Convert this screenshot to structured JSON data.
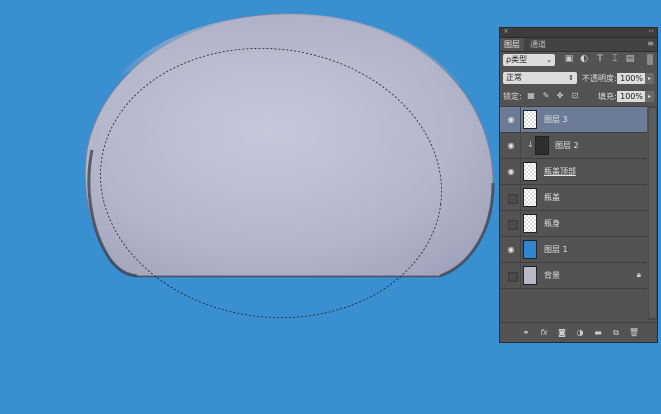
{
  "layers_panel": {
    "close_glyph": "×",
    "collapse_glyph": "‹‹",
    "tabs": [
      {
        "label": "图层",
        "active": true
      },
      {
        "label": "通道",
        "active": false
      }
    ],
    "panel_menu_icon": "panel-menu-icon",
    "filter": {
      "kind_label": "ρ类型",
      "icons": [
        "pixel-filter-icon",
        "adjustment-filter-icon",
        "type-filter-icon",
        "shape-filter-icon",
        "smart-object-filter-icon"
      ]
    },
    "blend_mode": "正常",
    "opacity_label": "不透明度:",
    "opacity_value": "100%",
    "lock_label": "锁定:",
    "lock_icons": [
      "lock-transparent-icon",
      "lock-paint-icon",
      "lock-position-icon",
      "lock-all-icon"
    ],
    "fill_label": "填充:",
    "fill_value": "100%",
    "layers": [
      {
        "name": "图层 3",
        "visible": true,
        "selected": true,
        "thumb": "transparent"
      },
      {
        "name": "图层 2",
        "visible": true,
        "selected": false,
        "thumb": "dark",
        "clipped": true
      },
      {
        "name": "瓶盖顶部",
        "visible": true,
        "selected": false,
        "thumb": "transparent",
        "underline": true
      },
      {
        "name": "瓶盖",
        "visible": false,
        "selected": false,
        "thumb": "transparent"
      },
      {
        "name": "瓶身",
        "visible": false,
        "selected": false,
        "thumb": "transparent"
      },
      {
        "name": "图层 1",
        "visible": true,
        "selected": false,
        "thumb": "blue"
      },
      {
        "name": "背景",
        "visible": false,
        "selected": false,
        "thumb": "grey",
        "locked": true
      }
    ],
    "bottom_buttons": [
      "link-layers-icon",
      "fx-icon",
      "add-mask-icon",
      "adjustment-layer-icon",
      "new-group-icon",
      "new-layer-icon",
      "delete-layer-icon"
    ]
  },
  "canvas": {
    "background_color": "#3a8fd1",
    "shape_color": "#b6b8cc",
    "marching_ants": true
  }
}
